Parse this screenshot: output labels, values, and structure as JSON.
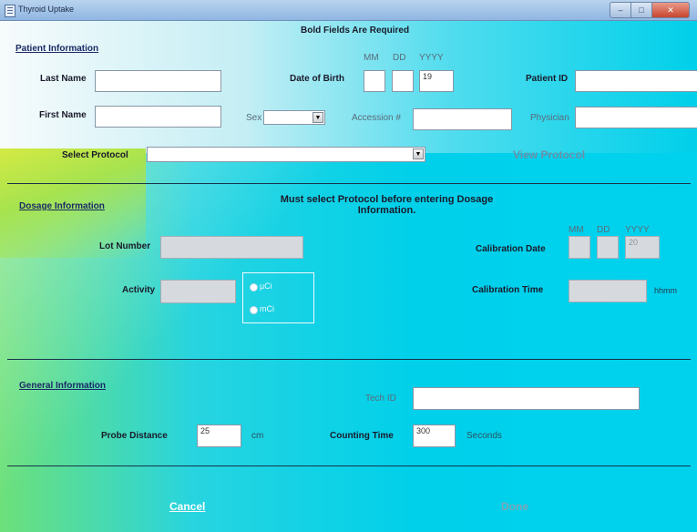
{
  "window": {
    "title": "Thyroid Uptake"
  },
  "header": {
    "required_note": "Bold Fields Are Required"
  },
  "patient": {
    "section_label": "Patient Information",
    "last_name_label": "Last Name",
    "first_name_label": "First Name",
    "dob_label": "Date of Birth",
    "dob_mm_header": "MM",
    "dob_dd_header": "DD",
    "dob_yyyy_header": "YYYY",
    "dob_yyyy_value": "19",
    "patient_id_label": "Patient ID",
    "sex_label": "Sex",
    "accession_label": "Accession #",
    "physician_label": "Physician",
    "protocol_label": "Select Protocol",
    "view_protocol_label": "View Protocol"
  },
  "dosage": {
    "section_label": "Dosage Information",
    "notice": "Must select Protocol before entering Dosage\nInformation.",
    "lot_label": "Lot Number",
    "activity_label": "Activity",
    "unit_uci": "µCi",
    "unit_mci": "mCi",
    "cal_date_label": "Calibration Date",
    "cal_mm_header": "MM",
    "cal_dd_header": "DD",
    "cal_yyyy_header": "YYYY",
    "cal_yyyy_value": "20",
    "cal_time_label": "Calibration Time",
    "time_unit": "hhmm"
  },
  "general": {
    "section_label": "General Information",
    "tech_id_label": "Tech ID",
    "probe_distance_label": "Probe Distance",
    "probe_distance_value": "25",
    "probe_distance_unit": "cm",
    "counting_time_label": "Counting Time",
    "counting_time_value": "300",
    "counting_time_unit": "Seconds"
  },
  "footer": {
    "cancel_label": "Cancel",
    "done_label": "Done"
  },
  "icons": {
    "dropdown": "chevron-down-icon",
    "minimize": "minimize-icon",
    "maximize": "maximize-icon",
    "close": "close-icon"
  }
}
